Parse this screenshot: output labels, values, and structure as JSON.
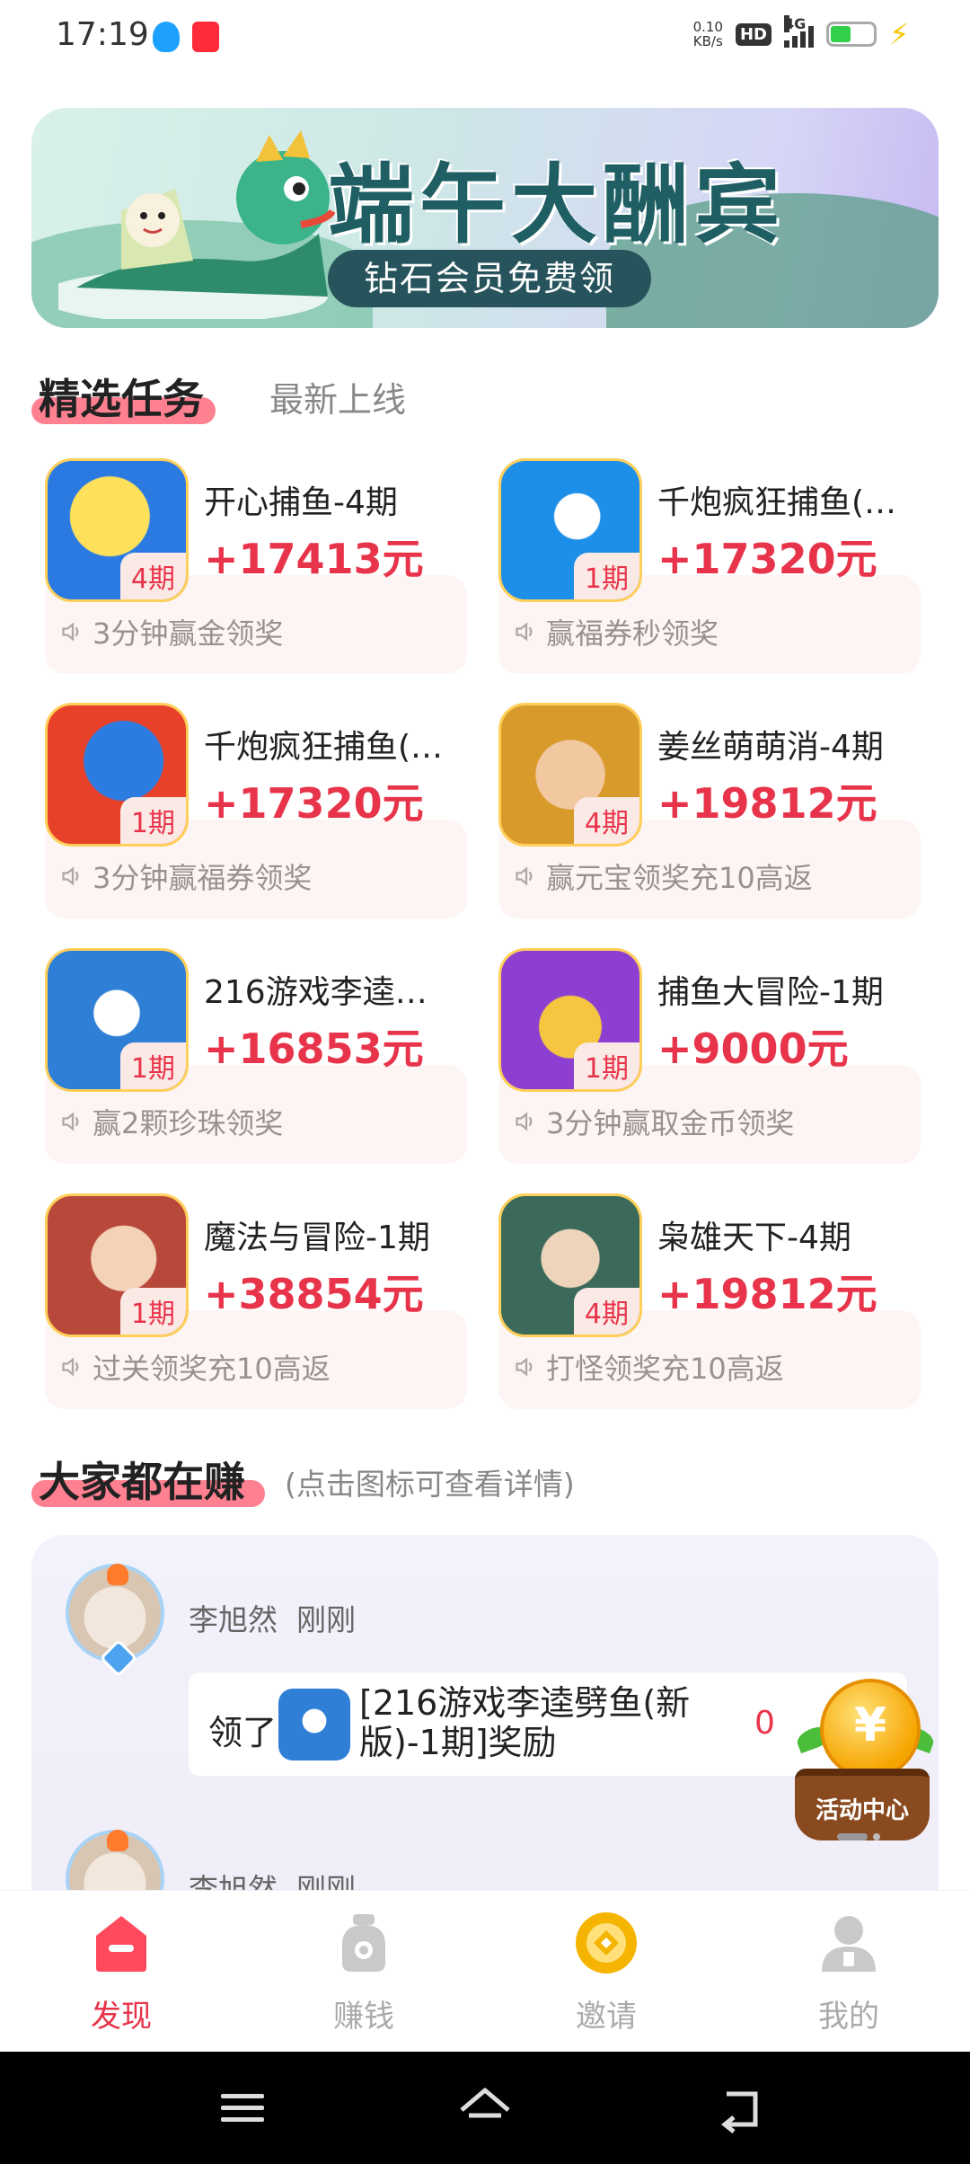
{
  "status_bar": {
    "time": "17:19",
    "net_speed_value": "0.10",
    "net_speed_unit": "KB/s",
    "hd": "HD",
    "network": "4G",
    "icons": [
      "qq-icon",
      "app-notify-icon",
      "signal-icon",
      "battery-icon",
      "charging-icon"
    ]
  },
  "banner": {
    "title": "端午大酬宾",
    "subtitle": "钻石会员免费领"
  },
  "tabs": {
    "active": "精选任务",
    "other": "最新上线"
  },
  "tasks": [
    {
      "title": "开心捕鱼-4期",
      "reward": "+17413元",
      "period": "4期",
      "note": "3分钟赢金领奖",
      "color": "#2a7ae2"
    },
    {
      "title": "千炮疯狂捕鱼(…",
      "reward": "+17320元",
      "period": "1期",
      "note": "赢福券秒领奖",
      "color": "#1d8fe8"
    },
    {
      "title": "千炮疯狂捕鱼(…",
      "reward": "+17320元",
      "period": "1期",
      "note": "3分钟赢福券领奖",
      "color": "#e8412a"
    },
    {
      "title": "姜丝萌萌消-4期",
      "reward": "+19812元",
      "period": "4期",
      "note": "赢元宝领奖充10高返",
      "color": "#d99a2c"
    },
    {
      "title": "216游戏李逵…",
      "reward": "+16853元",
      "period": "1期",
      "note": "赢2颗珍珠领奖",
      "color": "#2f7fd6"
    },
    {
      "title": "捕鱼大冒险-1期",
      "reward": "+9000元",
      "period": "1期",
      "note": "3分钟赢取金币领奖",
      "color": "#8d3fd1"
    },
    {
      "title": "魔法与冒险-1期",
      "reward": "+38854元",
      "period": "1期",
      "note": "过关领奖充10高返",
      "color": "#b8483a"
    },
    {
      "title": "枭雄天下-4期",
      "reward": "+19812元",
      "period": "4期",
      "note": "打怪领奖充10高返",
      "color": "#3b6a5a"
    }
  ],
  "earning": {
    "title": "大家都在赚",
    "hint": "(点击图标可查看详情)",
    "items": [
      {
        "name": "李旭然",
        "time": "刚刚",
        "prefix": "领了",
        "text": "[216游戏李逵劈鱼(新版)-1期]奖励",
        "amount": "0"
      },
      {
        "name": "李旭然",
        "time": "刚刚"
      }
    ]
  },
  "activity": {
    "label": "活动中心"
  },
  "bottom_nav": [
    {
      "label": "发现",
      "icon": "discover-icon",
      "active": true
    },
    {
      "label": "赚钱",
      "icon": "money-bag-icon",
      "active": false
    },
    {
      "label": "邀请",
      "icon": "invite-coin-icon",
      "active": false
    },
    {
      "label": "我的",
      "icon": "profile-icon",
      "active": false
    }
  ],
  "colors": {
    "accent": "#e8344a",
    "tab_highlight": "#ff6a7e"
  }
}
